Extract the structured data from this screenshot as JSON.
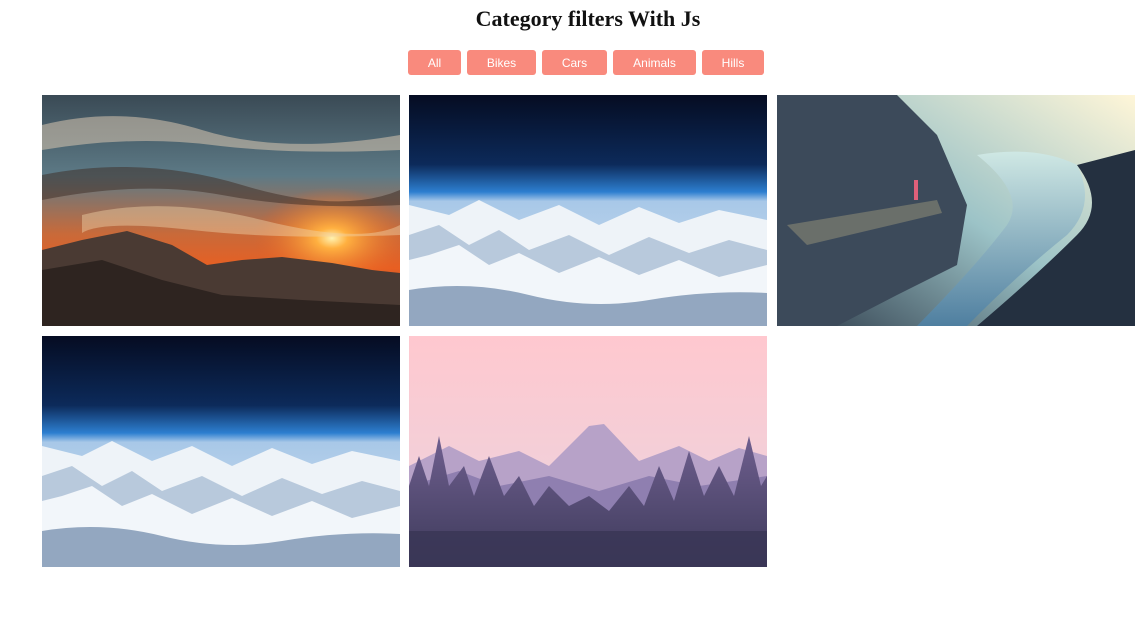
{
  "page": {
    "title": "Category filters With Js"
  },
  "filters": [
    {
      "label": "All"
    },
    {
      "label": "Bikes"
    },
    {
      "label": "Cars"
    },
    {
      "label": "Animals"
    },
    {
      "label": "Hills"
    }
  ],
  "theme": {
    "button_color": "#f98a7d",
    "button_text_color": "#ffffff"
  },
  "gallery": {
    "images": [
      {
        "category": "hills",
        "depicts": "mountain sunset"
      },
      {
        "category": "hills",
        "depicts": "snowy mountains from above"
      },
      {
        "category": "hills",
        "depicts": "cliff over lake"
      },
      {
        "category": "hills",
        "depicts": "snowy mountains from above"
      },
      {
        "category": "hills",
        "depicts": "pink forest mountain illustration"
      }
    ]
  }
}
